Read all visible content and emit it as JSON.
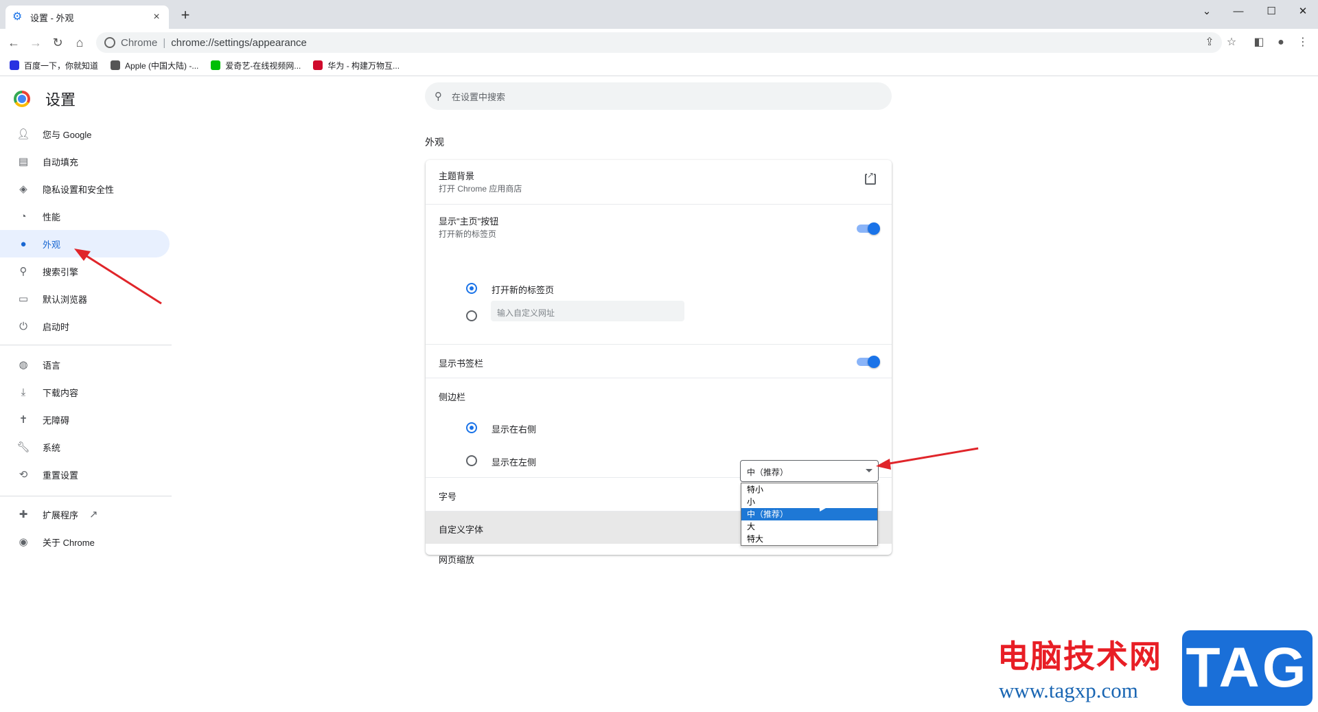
{
  "window": {
    "tab_title": "设置 - 外观",
    "close_tab": "×",
    "new_tab": "+"
  },
  "toolbar": {
    "site_label": "Chrome",
    "url": "chrome://settings/appearance"
  },
  "bookmarks": [
    {
      "label": "百度一下，你就知道",
      "color": "#2932e1"
    },
    {
      "label": "Apple (中国大陆) -...",
      "color": "#555555"
    },
    {
      "label": "爱奇艺-在线视频网...",
      "color": "#00be06"
    },
    {
      "label": "华为 - 构建万物互...",
      "color": "#cf0a2c"
    }
  ],
  "sidebar": {
    "title": "设置",
    "items": [
      {
        "label": "您与 Google",
        "icon": "person-icon"
      },
      {
        "label": "自动填充",
        "icon": "clipboard-icon"
      },
      {
        "label": "隐私设置和安全性",
        "icon": "shield-icon"
      },
      {
        "label": "性能",
        "icon": "speedometer-icon"
      },
      {
        "label": "外观",
        "icon": "palette-icon"
      },
      {
        "label": "搜索引擎",
        "icon": "search-icon"
      },
      {
        "label": "默认浏览器",
        "icon": "browser-icon"
      },
      {
        "label": "启动时",
        "icon": "power-icon"
      },
      {
        "label": "语言",
        "icon": "globe-icon"
      },
      {
        "label": "下载内容",
        "icon": "download-icon"
      },
      {
        "label": "无障碍",
        "icon": "accessibility-icon"
      },
      {
        "label": "系统",
        "icon": "wrench-icon"
      },
      {
        "label": "重置设置",
        "icon": "history-icon"
      },
      {
        "label": "扩展程序",
        "icon": "puzzle-icon"
      },
      {
        "label": "关于 Chrome",
        "icon": "chrome-icon"
      }
    ]
  },
  "search": {
    "placeholder": "在设置中搜索"
  },
  "section": {
    "title": "外观"
  },
  "settings": {
    "theme_title": "主题背景",
    "theme_sub": "打开 Chrome 应用商店",
    "home_title": "显示\"主页\"按钮",
    "home_sub": "打开新的标签页",
    "home_opt1": "打开新的标签页",
    "home_opt2_placeholder": "输入自定义网址",
    "bookmarks_bar": "显示书签栏",
    "sidebar_title": "侧边栏",
    "sidebar_right": "显示在右侧",
    "sidebar_left": "显示在左侧",
    "font_size": "字号",
    "custom_font": "自定义字体",
    "page_zoom": "网页缩放"
  },
  "font_select": {
    "value": "中（推荐）",
    "options": [
      "特小",
      "小",
      "中（推荐）",
      "大",
      "特大"
    ]
  },
  "watermark": {
    "cn": "电脑技术网",
    "url": "www.tagxp.com",
    "tag": "TAG"
  }
}
